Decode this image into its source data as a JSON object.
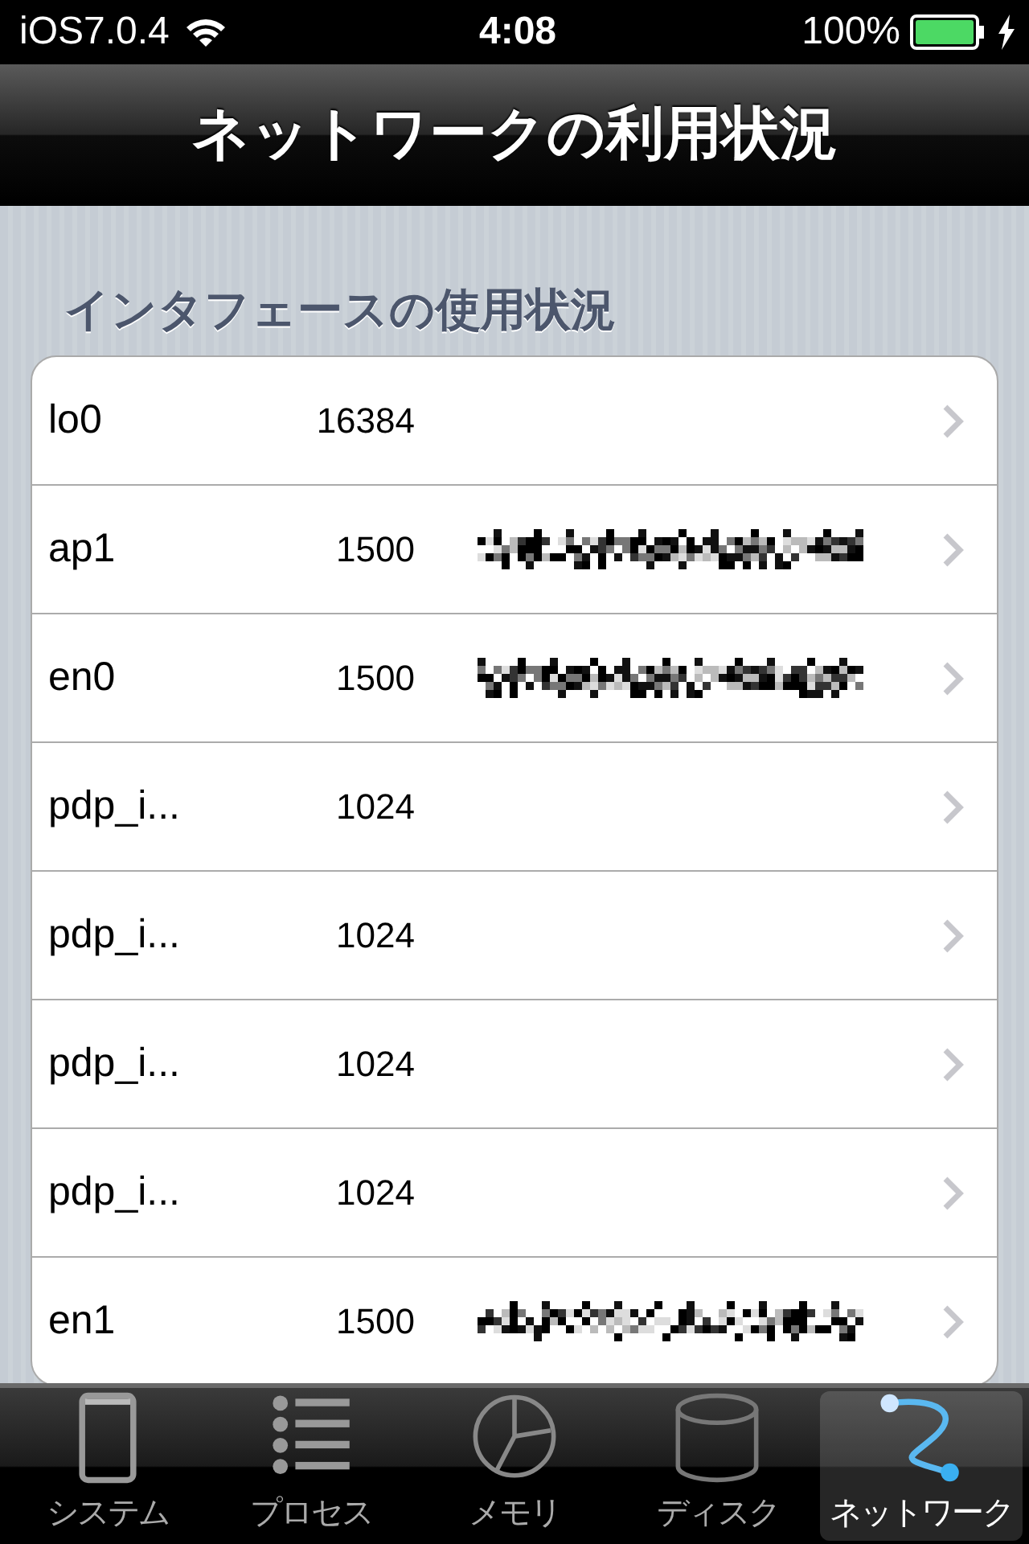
{
  "status_bar": {
    "carrier": "iOS7.0.4",
    "time": "4:08",
    "battery": "100%"
  },
  "nav_bar": {
    "title": "ネットワークの利用状況"
  },
  "section": {
    "header": "インタフェースの使用状況"
  },
  "interfaces": [
    {
      "name": "lo0",
      "mtu": "16384",
      "address_hidden": false
    },
    {
      "name": "ap1",
      "mtu": "1500",
      "address_hidden": true
    },
    {
      "name": "en0",
      "mtu": "1500",
      "address_hidden": true
    },
    {
      "name": "pdp_i...",
      "mtu": "1024",
      "address_hidden": false
    },
    {
      "name": "pdp_i...",
      "mtu": "1024",
      "address_hidden": false
    },
    {
      "name": "pdp_i...",
      "mtu": "1024",
      "address_hidden": false
    },
    {
      "name": "pdp_i...",
      "mtu": "1024",
      "address_hidden": false
    },
    {
      "name": "en1",
      "mtu": "1500",
      "address_hidden": true
    }
  ],
  "tab_bar": [
    {
      "label": "システム",
      "selected": false
    },
    {
      "label": "プロセス",
      "selected": false
    },
    {
      "label": "メモリ",
      "selected": false
    },
    {
      "label": "ディスク",
      "selected": false
    },
    {
      "label": "ネットワーク",
      "selected": true
    }
  ]
}
